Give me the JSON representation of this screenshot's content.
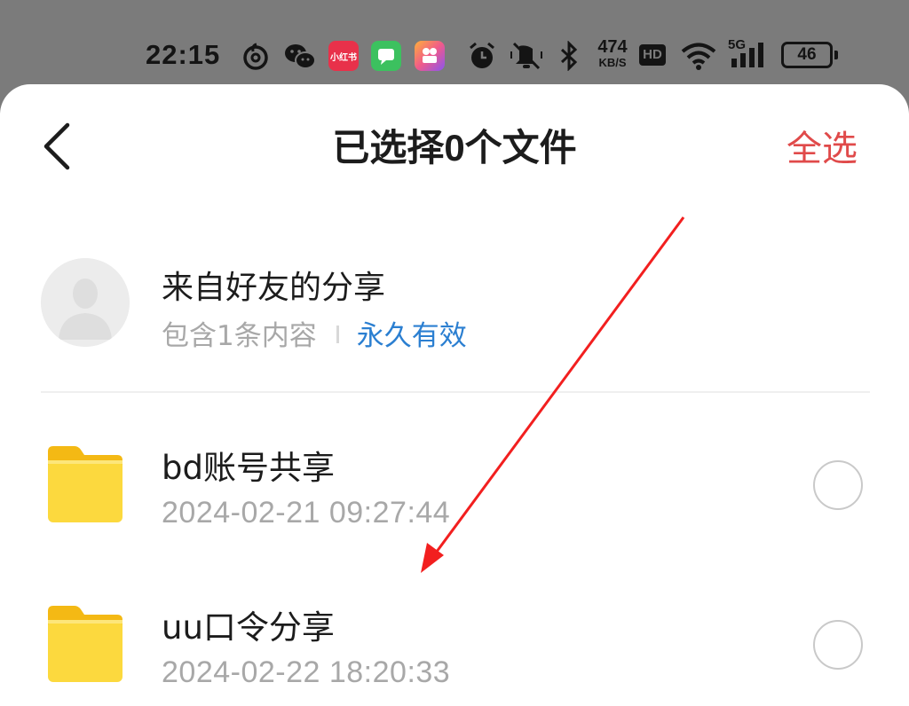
{
  "status_bar": {
    "time": "22:15",
    "icons": [
      "netease-music-icon",
      "wechat-icon",
      "xiaohongshu-app-icon",
      "messages-app-icon",
      "video-app-icon",
      "alarm-icon",
      "mute-icon",
      "bluetooth-icon",
      "wifi-icon",
      "signal-icon"
    ],
    "xiaohongshu_label": "小红书",
    "net_speed_value": "474",
    "net_speed_unit": "KB/S",
    "hd_label": "HD",
    "network_label": "5G",
    "battery": "46"
  },
  "header": {
    "back_icon": "chevron-left-icon",
    "title": "已选择0个文件",
    "select_all": "全选"
  },
  "sender": {
    "name": "来自好友的分享",
    "count": "包含1条内容",
    "validity": "永久有效"
  },
  "files": [
    {
      "name": "bd账号共享",
      "date": "2024-02-21 09:27:44",
      "icon": "folder-icon"
    },
    {
      "name": "uu口令分享",
      "date": "2024-02-22 18:20:33",
      "icon": "folder-icon"
    }
  ],
  "colors": {
    "accent_red": "#e04a4a",
    "link_blue": "#2b7fd1",
    "folder_yellow": "#fcd93e",
    "annotation_arrow": "#f21f1f"
  }
}
